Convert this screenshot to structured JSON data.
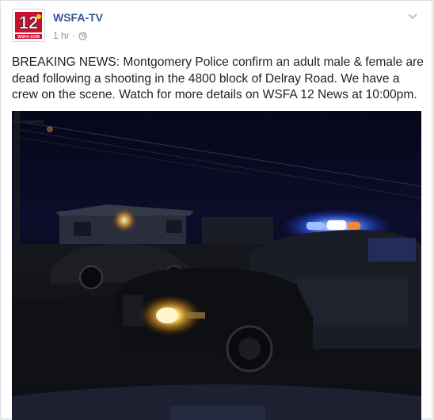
{
  "post": {
    "page_name": "WSFA-TV",
    "time": "1 hr",
    "privacy_icon": "globe-icon",
    "menu_icon": "chevron-down-icon",
    "text": "BREAKING NEWS: Montgomery Police confirm an adult male & female are dead following a shooting in the 4800 block of Delray Road. We have a crew on the scene. Watch for more details on WSFA 12 News at 10:00pm."
  },
  "logo": {
    "number": "12",
    "tagline": "WSFA.COM"
  },
  "colors": {
    "link": "#365899",
    "text": "#1d2129",
    "meta": "#90949c",
    "logo_red": "#c8102e"
  }
}
